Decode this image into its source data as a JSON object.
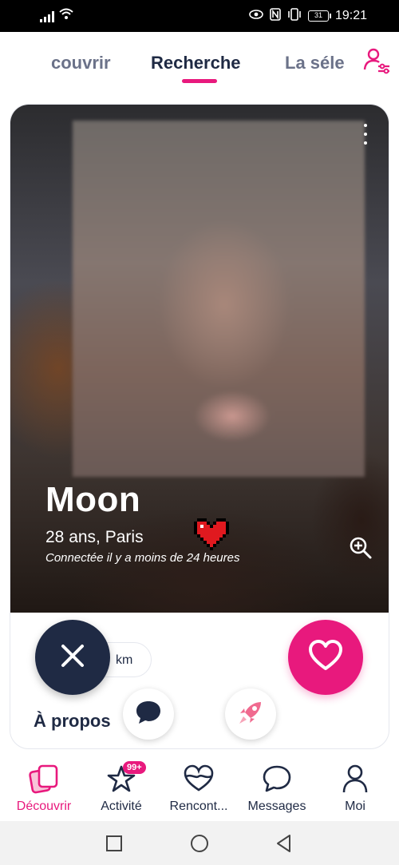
{
  "status_bar": {
    "time": "19:21",
    "battery": "31",
    "colors": {
      "background": "#000000",
      "text": "#ffffff"
    },
    "icons": [
      "signal-icon",
      "wifi-icon",
      "eye-icon",
      "nfc-icon",
      "vibrate-icon",
      "battery-icon"
    ]
  },
  "tabs": {
    "items": [
      {
        "label": "couvrir",
        "active": false
      },
      {
        "label": "Recherche",
        "active": true
      },
      {
        "label": "La séle",
        "active": false
      }
    ],
    "accent": "#e8197d"
  },
  "filter_button": {
    "icon": "user-filter-icon"
  },
  "profile": {
    "name": "Moon",
    "age_city": "28 ans, Paris",
    "last_seen": "Connectée il y a moins de 24 heures",
    "distance_unit": "km",
    "about_title": "À propos"
  },
  "actions": {
    "dislike_icon": "close-icon",
    "like_icon": "heart-icon",
    "message_icon": "chat-icon",
    "boost_icon": "rocket-icon",
    "zoom_icon": "zoom-in-icon",
    "more_icon": "more-vertical-icon",
    "colors": {
      "dislike": "#1f2a44",
      "like": "#e8197d"
    }
  },
  "bottom_nav": {
    "items": [
      {
        "label": "Découvrir",
        "icon": "cards-icon",
        "active": true
      },
      {
        "label": "Activité",
        "icon": "star-icon",
        "active": false,
        "badge": "99+"
      },
      {
        "label": "Rencont...",
        "icon": "matches-heart-icon",
        "active": false
      },
      {
        "label": "Messages",
        "icon": "chat-bubble-icon",
        "active": false
      },
      {
        "label": "Moi",
        "icon": "person-icon",
        "active": false
      }
    ]
  },
  "system_nav": {
    "buttons": [
      "recents-button",
      "home-button",
      "back-button"
    ]
  }
}
